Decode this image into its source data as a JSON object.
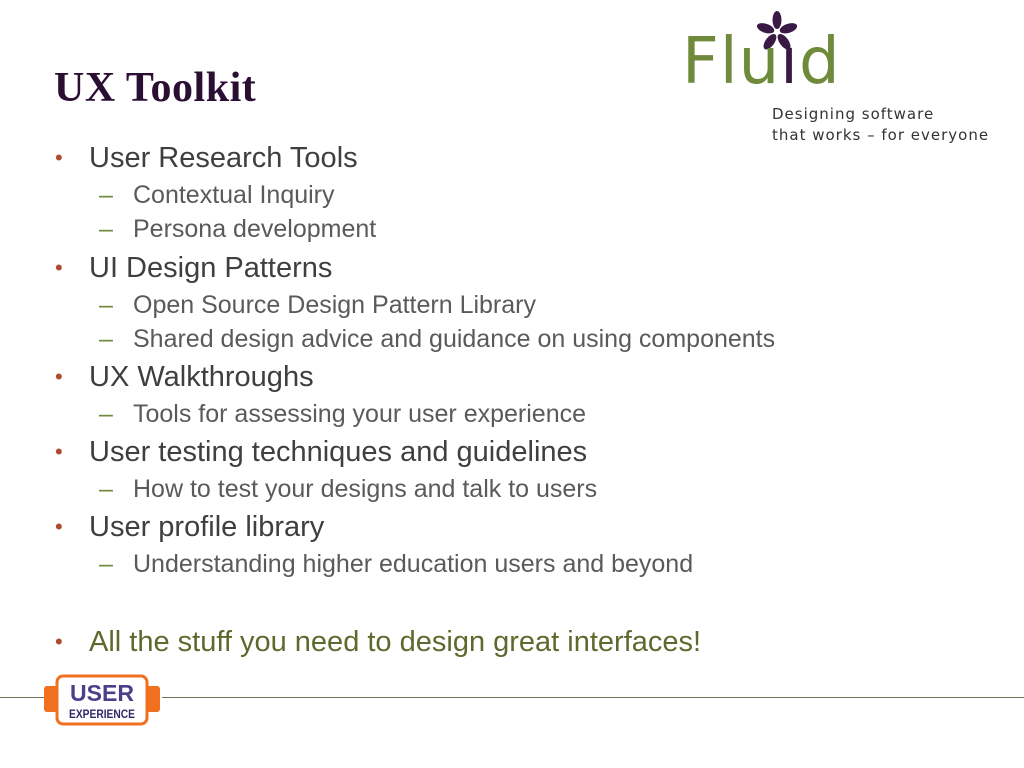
{
  "slide": {
    "title": "UX Toolkit",
    "logo": {
      "name": "Fluid",
      "tagline_line1": "Designing software",
      "tagline_line2": "that works – for everyone",
      "colors": {
        "green": "#6f8a3a",
        "purple": "#3a1a45"
      }
    },
    "bullets": [
      {
        "text": "User Research Tools",
        "subs": [
          "Contextual Inquiry",
          "Persona development"
        ]
      },
      {
        "text": "UI Design Patterns",
        "subs": [
          "Open Source Design Pattern Library",
          "Shared design advice and guidance on using components"
        ]
      },
      {
        "text": "UX Walkthroughs",
        "subs": [
          "Tools for assessing your user experience"
        ]
      },
      {
        "text": "User testing techniques and guidelines",
        "subs": [
          "How to test your designs and talk to users"
        ]
      },
      {
        "text": "User profile library",
        "subs": [
          "Understanding higher education users and beyond"
        ]
      },
      {
        "text": "All the stuff you need to design great interfaces!",
        "subs": []
      }
    ],
    "bullet_glyph": "•",
    "dash_glyph": "–",
    "footer_badge": {
      "line1": "USER",
      "line2": "EXPERIENCE",
      "border_color": "#f07020",
      "text_color": "#4b3f8a"
    }
  }
}
